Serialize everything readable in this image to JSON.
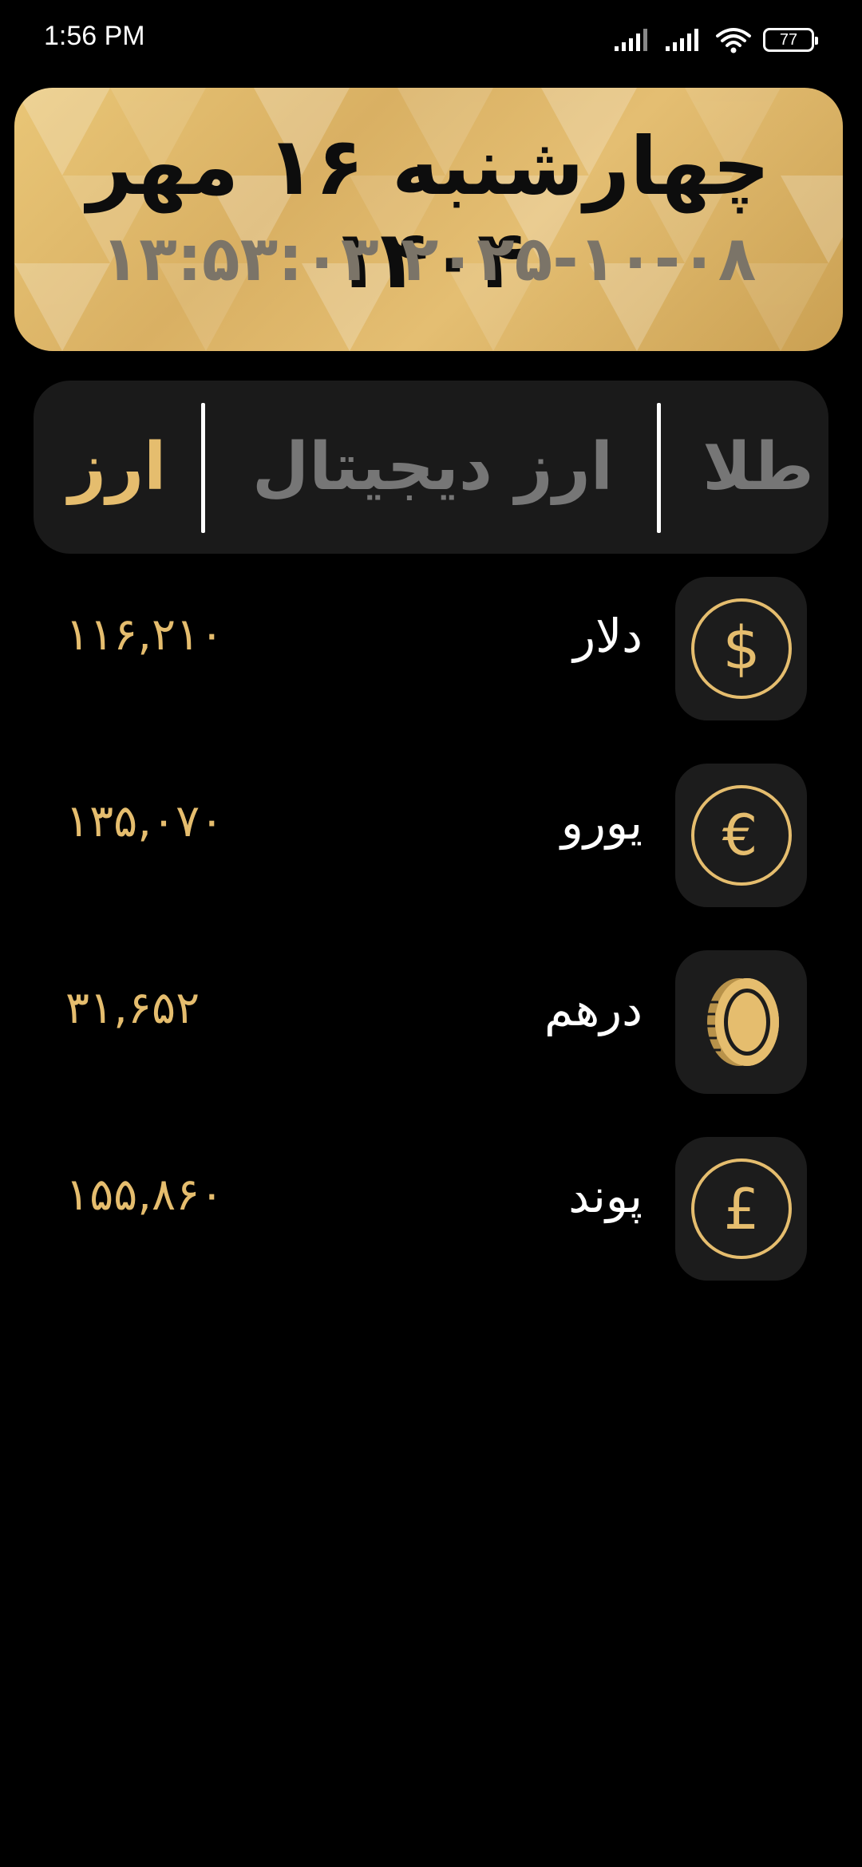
{
  "status_bar": {
    "time": "1:56 PM",
    "battery": "77",
    "icons": [
      "signal-icon",
      "signal-icon",
      "wifi-icon",
      "battery-icon"
    ]
  },
  "date_card": {
    "persian_date": "چهارشنبه ۱۶ مهر ۱۴۰۴",
    "gregorian_datetime": "۲۰۲۵-۱۰-۰۸ ۱۳:۵۳:۰۳"
  },
  "tabs": {
    "gold": "طلا",
    "crypto": "ارز دیجیتال",
    "currency": "ارز",
    "active": "currency"
  },
  "currencies": [
    {
      "name": "دلار",
      "price": "۱۱۶,۲۱۰",
      "icon": "dollar-icon"
    },
    {
      "name": "یورو",
      "price": "۱۳۵,۰۷۰",
      "icon": "euro-icon"
    },
    {
      "name": "درهم",
      "price": "۳۱,۶۵۲",
      "icon": "coin-icon"
    },
    {
      "name": "پوند",
      "price": "۱۵۵,۸۶۰",
      "icon": "pound-icon"
    }
  ],
  "colors": {
    "accent_gold": "#e5bd6e",
    "background": "#000000",
    "surface": "#1a1a1a",
    "tab_inactive": "#767676"
  }
}
